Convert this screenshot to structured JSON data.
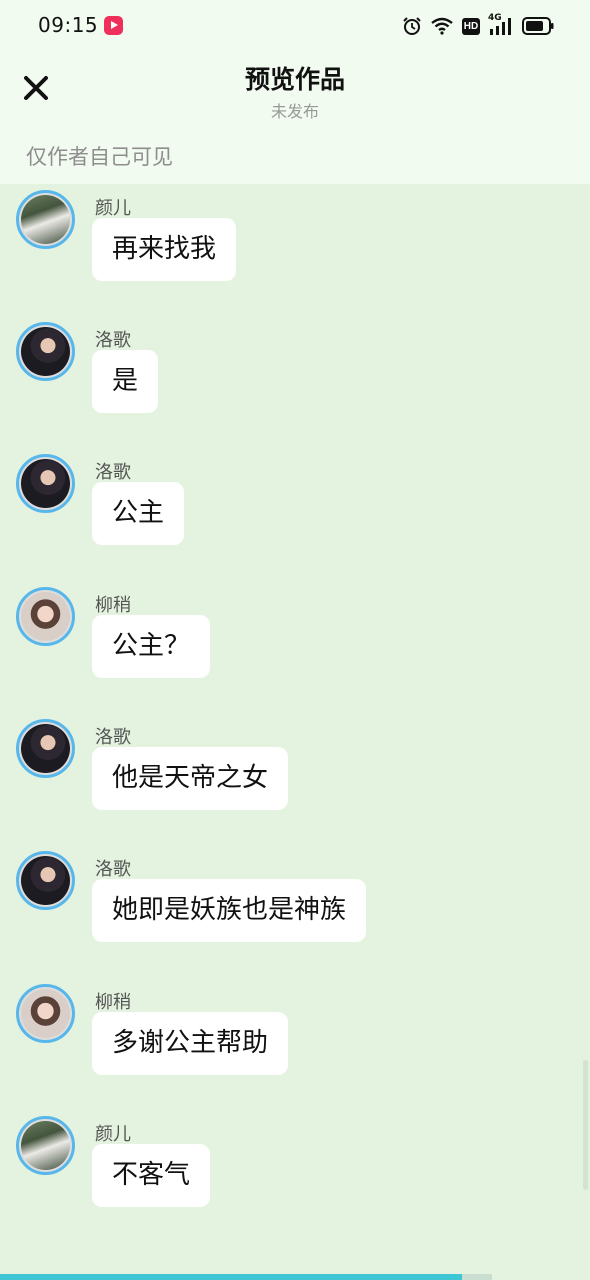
{
  "status_bar": {
    "time": "09:15",
    "icons": [
      "app-badge-icon",
      "alarm-icon",
      "wifi-icon",
      "hd-icon",
      "signal-4g-icon",
      "battery-icon"
    ],
    "hd_text": "HD",
    "network_text": "4G"
  },
  "header": {
    "title": "预览作品",
    "subtitle": "未发布",
    "close_icon": "close-icon"
  },
  "visibility_note": "仅作者自己可见",
  "messages": [
    {
      "sender": "颜儿",
      "text": "再来找我",
      "avatar": "yan"
    },
    {
      "sender": "洛歌",
      "text": "是",
      "avatar": "luo"
    },
    {
      "sender": "洛歌",
      "text": "公主",
      "avatar": "luo"
    },
    {
      "sender": "柳稍",
      "text": "公主？",
      "avatar": "liu"
    },
    {
      "sender": "洛歌",
      "text": "他是天帝之女",
      "avatar": "luo"
    },
    {
      "sender": "洛歌",
      "text": "她即是妖族也是神族",
      "avatar": "luo"
    },
    {
      "sender": "柳稍",
      "text": "多谢公主帮助",
      "avatar": "liu"
    },
    {
      "sender": "颜儿",
      "text": "不客气",
      "avatar": "yan"
    }
  ],
  "playback_progress": 0.94,
  "colors": {
    "background": "#e4f3df",
    "header_bg": "#f2fbf0",
    "avatar_ring": "#58b7ea",
    "progress": "#3fc6d5"
  }
}
